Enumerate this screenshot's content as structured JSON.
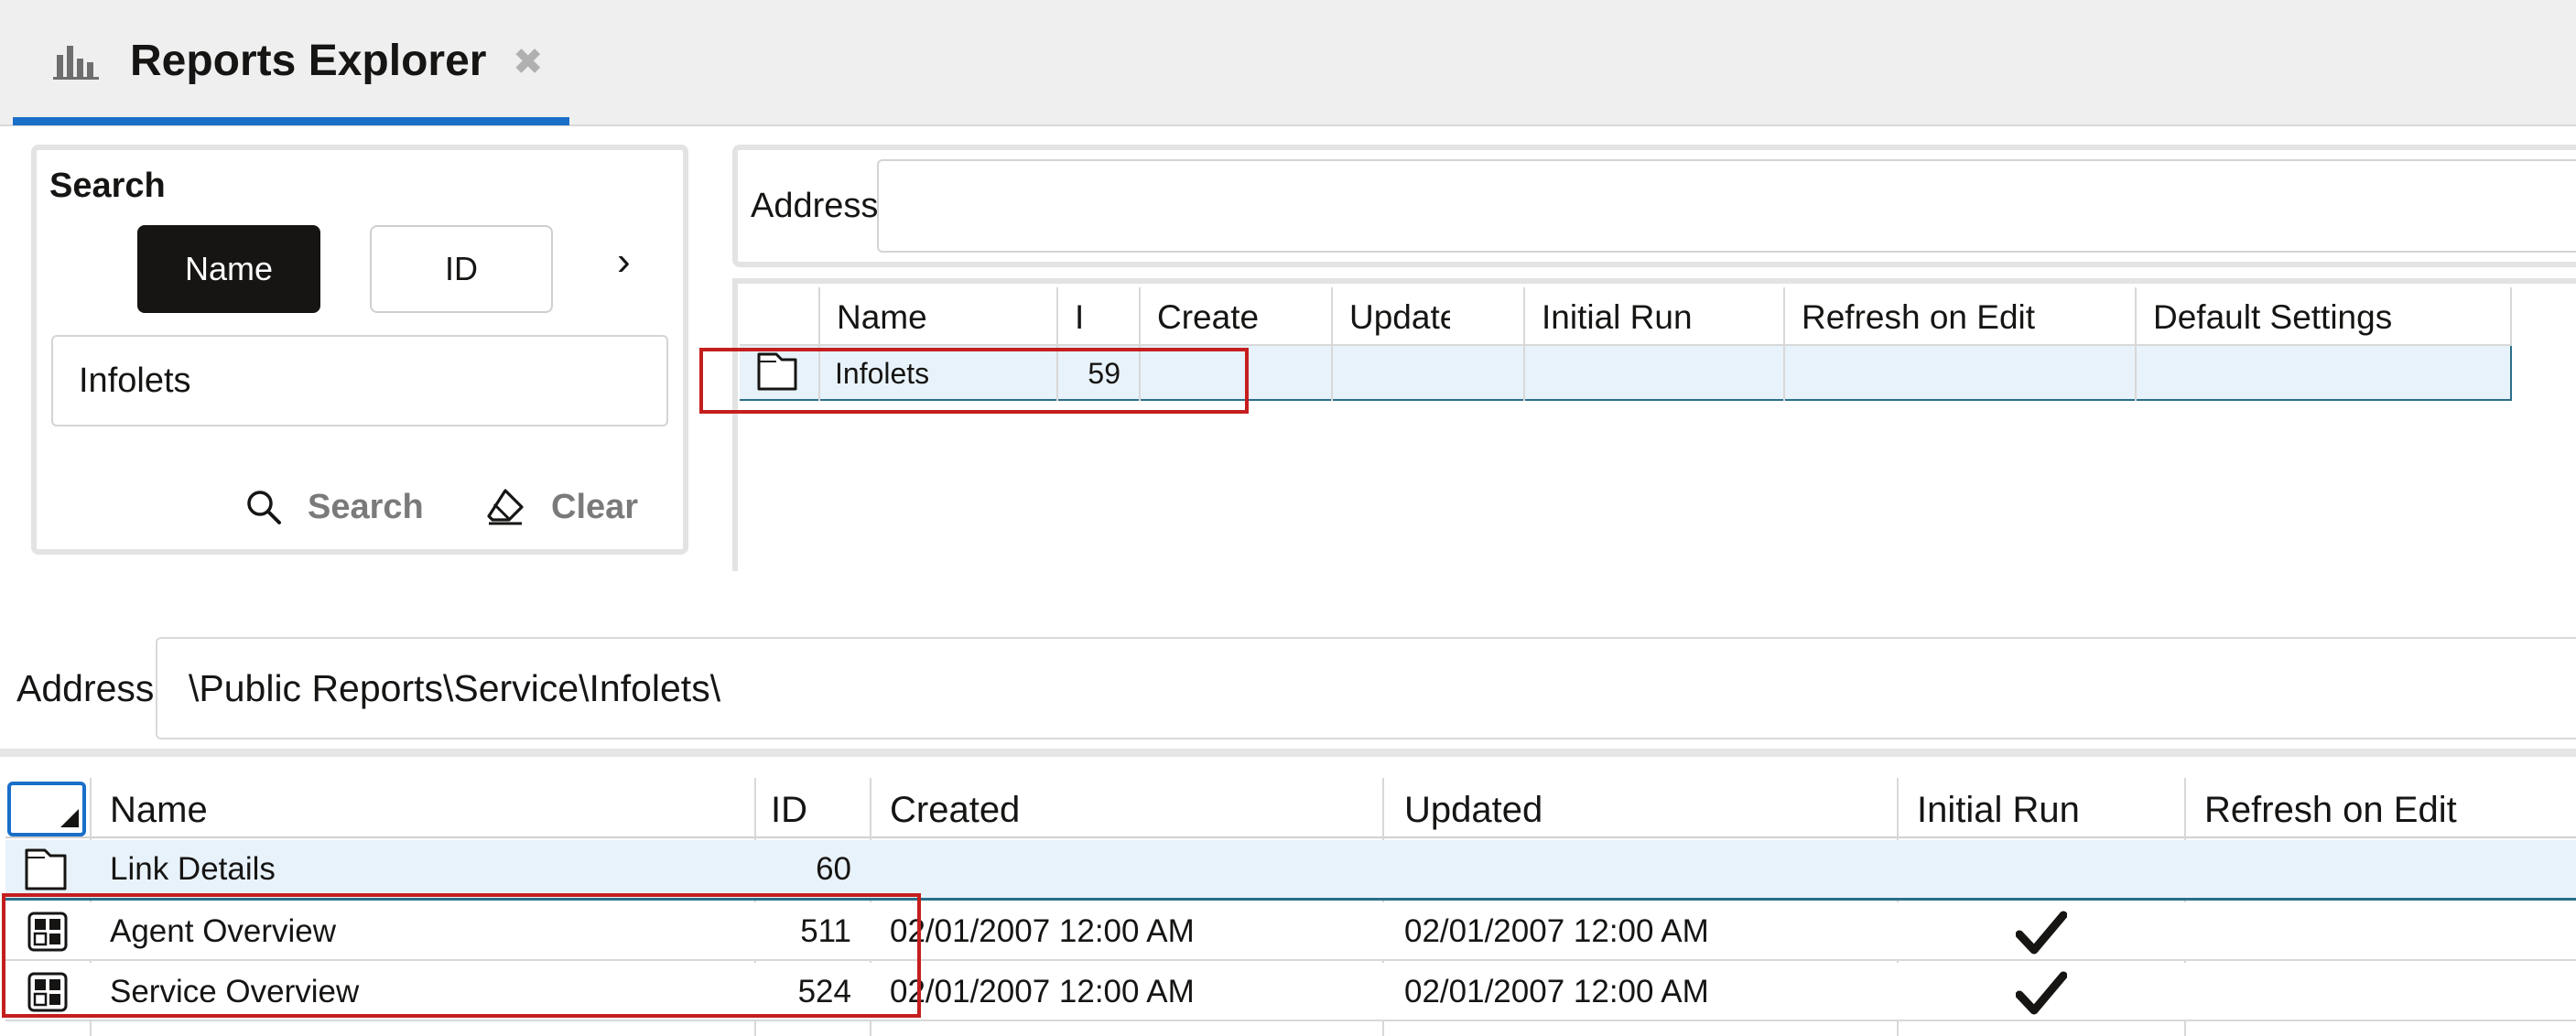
{
  "tab": {
    "title": "Reports Explorer",
    "icon": "bar-chart-icon",
    "close_glyph": "✖",
    "accent": "#1a6fc9"
  },
  "search_panel": {
    "heading": "Search",
    "toggles": [
      {
        "label": "Name",
        "selected": true
      },
      {
        "label": "ID",
        "selected": false
      }
    ],
    "more_glyph": "›",
    "query_value": "Infolets",
    "search_label": "Search",
    "clear_label": "Clear"
  },
  "top_browser": {
    "address_label": "Address",
    "address_value": "",
    "columns": [
      "Name",
      "ID",
      "Created",
      "Updated",
      "Initial Run",
      "Refresh on Edit",
      "Default Settings"
    ],
    "rows": [
      {
        "icon": "folder-icon",
        "name": "Infolets",
        "id": "59",
        "created": "",
        "updated": "",
        "initial_run": false
      }
    ]
  },
  "bottom_browser": {
    "address_label": "Address",
    "address_value": "\\Public Reports\\Service\\Infolets\\",
    "columns": [
      "Name",
      "ID",
      "Created",
      "Updated",
      "Initial Run",
      "Refresh on Edit"
    ],
    "rows": [
      {
        "icon": "folder-icon",
        "name": "Link Details",
        "id": "60",
        "created": "",
        "updated": "",
        "initial_run": false
      },
      {
        "icon": "dashboard-report-icon",
        "name": "Agent Overview",
        "id": "511",
        "created": "02/01/2007 12:00 AM",
        "updated": "02/01/2007 12:00 AM",
        "initial_run": true
      },
      {
        "icon": "dashboard-report-icon",
        "name": "Service Overview",
        "id": "524",
        "created": "02/01/2007 12:00 AM",
        "updated": "02/01/2007 12:00 AM",
        "initial_run": true
      }
    ]
  },
  "colors": {
    "selected_row": "#e8f2fa",
    "highlight_box": "#c41e1e",
    "selected_row_border": "#2a6f8a"
  }
}
